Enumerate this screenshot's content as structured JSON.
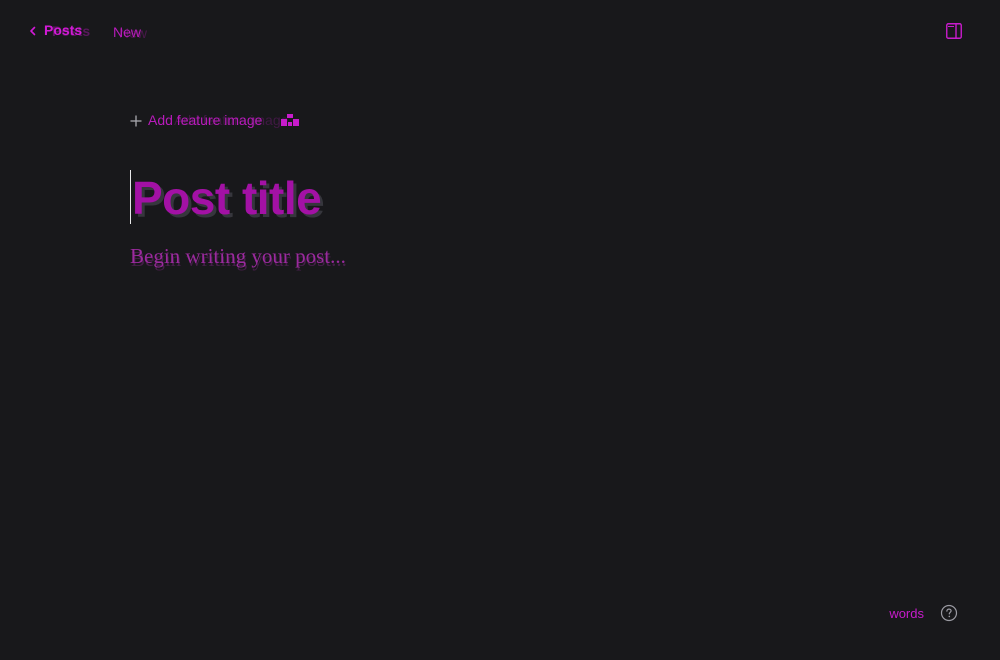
{
  "topbar": {
    "back_label": "Posts",
    "status_label": "New"
  },
  "editor": {
    "add_feature_image_label": "Add feature image",
    "title_placeholder": "Post title",
    "body_placeholder": "Begin writing your post..."
  },
  "footer": {
    "word_count_label": "words"
  },
  "colors": {
    "background": "#18181b",
    "accent": "#d21ad7",
    "caret": "#e8e8ea"
  },
  "icons": {
    "back": "chevron-left-icon",
    "sidebar_toggle": "sidebar-panel-icon",
    "add": "plus-icon",
    "unsplash": "unsplash-icon",
    "help": "help-circle-icon"
  }
}
